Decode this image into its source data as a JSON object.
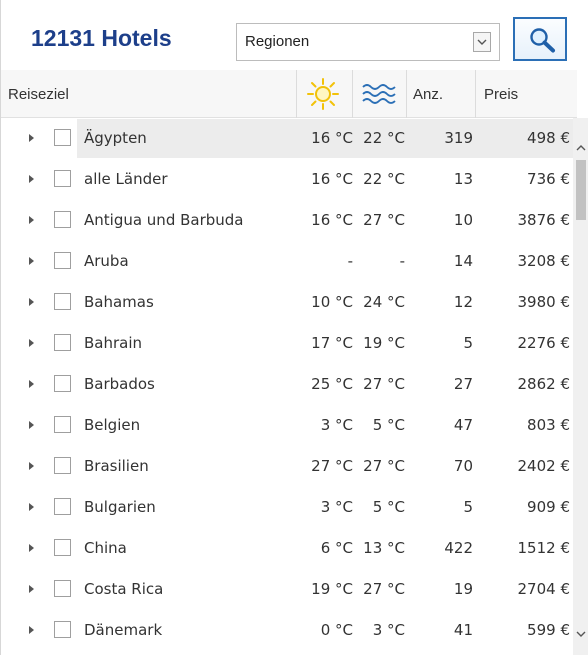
{
  "header": {
    "hotel_count": "12131 Hotels",
    "region_select": {
      "selected": "Regionen",
      "icon": "chevron-down-icon"
    },
    "search_button": {
      "icon": "search-icon"
    }
  },
  "columns": {
    "destination": "Reiseziel",
    "air_temp_icon": "sun-icon",
    "water_temp_icon": "waves-icon",
    "count": "Anz.",
    "price": "Preis"
  },
  "colors": {
    "title": "#1d3f8a",
    "accent": "#2b6fb6",
    "sun": "#f2c20a",
    "water": "#2b6fb6",
    "selected_row": "#ececec"
  },
  "rows": [
    {
      "name": "Ägypten",
      "air": "16 °C",
      "water": "22 °C",
      "count": "319",
      "price": "498 €",
      "selected": true
    },
    {
      "name": "alle Länder",
      "air": "16 °C",
      "water": "22 °C",
      "count": "13",
      "price": "736 €",
      "selected": false
    },
    {
      "name": "Antigua und Barbuda",
      "air": "16 °C",
      "water": "27 °C",
      "count": "10",
      "price": "3876 €",
      "selected": false
    },
    {
      "name": "Aruba",
      "air": "-",
      "water": "-",
      "count": "14",
      "price": "3208 €",
      "selected": false
    },
    {
      "name": "Bahamas",
      "air": "10 °C",
      "water": "24 °C",
      "count": "12",
      "price": "3980 €",
      "selected": false
    },
    {
      "name": "Bahrain",
      "air": "17 °C",
      "water": "19 °C",
      "count": "5",
      "price": "2276 €",
      "selected": false
    },
    {
      "name": "Barbados",
      "air": "25 °C",
      "water": "27 °C",
      "count": "27",
      "price": "2862 €",
      "selected": false
    },
    {
      "name": "Belgien",
      "air": "3 °C",
      "water": "5 °C",
      "count": "47",
      "price": "803 €",
      "selected": false
    },
    {
      "name": "Brasilien",
      "air": "27 °C",
      "water": "27 °C",
      "count": "70",
      "price": "2402 €",
      "selected": false
    },
    {
      "name": "Bulgarien",
      "air": "3 °C",
      "water": "5 °C",
      "count": "5",
      "price": "909 €",
      "selected": false
    },
    {
      "name": "China",
      "air": "6 °C",
      "water": "13 °C",
      "count": "422",
      "price": "1512 €",
      "selected": false
    },
    {
      "name": "Costa Rica",
      "air": "19 °C",
      "water": "27 °C",
      "count": "19",
      "price": "2704 €",
      "selected": false
    },
    {
      "name": "Dänemark",
      "air": "0 °C",
      "water": "3 °C",
      "count": "41",
      "price": "599 €",
      "selected": false
    }
  ]
}
